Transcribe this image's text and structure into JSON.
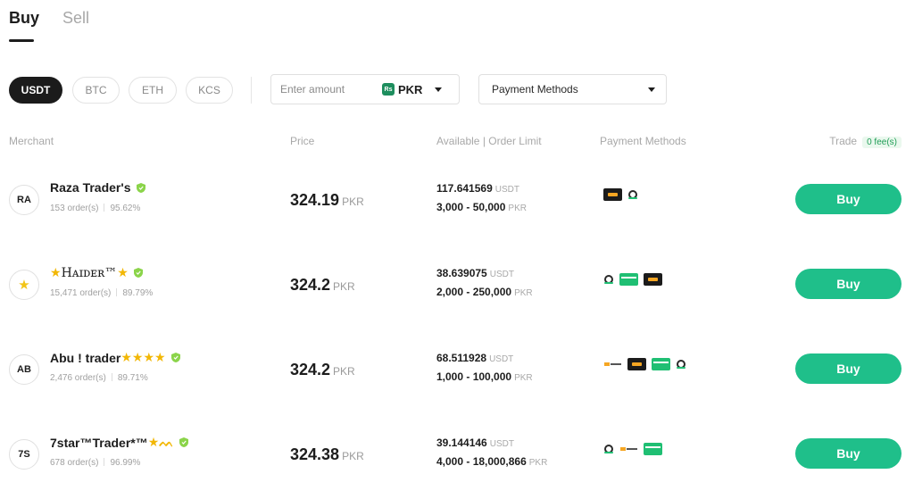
{
  "tabs": [
    {
      "label": "Buy",
      "active": true
    },
    {
      "label": "Sell",
      "active": false
    }
  ],
  "coins": [
    {
      "label": "USDT",
      "active": true
    },
    {
      "label": "BTC",
      "active": false
    },
    {
      "label": "ETH",
      "active": false
    },
    {
      "label": "KCS",
      "active": false
    }
  ],
  "amount": {
    "placeholder": "Enter amount",
    "currency": "PKR",
    "currency_icon": "Rs"
  },
  "payment_filter": {
    "label": "Payment Methods"
  },
  "headers": {
    "merchant": "Merchant",
    "price": "Price",
    "available": "Available | Order Limit",
    "payment": "Payment Methods",
    "trade": "Trade",
    "fee": "0 fee(s)"
  },
  "colors": {
    "accent": "#1fbf8a",
    "verified": "#8bd44a"
  },
  "rows": [
    {
      "avatar": "RA",
      "name": "Raza Trader's",
      "stars": "",
      "orders": "153 order(s)",
      "completion": "95.62%",
      "price": "324.19",
      "price_unit": "PKR",
      "available": "117.641569",
      "available_unit": "USDT",
      "limit": "3,000 - 50,000",
      "limit_unit": "PKR",
      "payment_methods": [
        "jazzcash-icon",
        "easypaisa-icon"
      ],
      "button": "Buy"
    },
    {
      "avatar": "★",
      "name": "Hᴀɪᴅᴇʀ™",
      "stars": "★",
      "stars_prefix": "★",
      "orders": "15,471 order(s)",
      "completion": "89.79%",
      "price": "324.2",
      "price_unit": "PKR",
      "available": "38.639075",
      "available_unit": "USDT",
      "limit": "2,000 - 250,000",
      "limit_unit": "PKR",
      "payment_methods": [
        "easypaisa-icon",
        "bank-card-icon",
        "jazzcash-icon"
      ],
      "button": "Buy"
    },
    {
      "avatar": "AB",
      "name": "Abu ! trader",
      "stars": "★★★★",
      "orders": "2,476 order(s)",
      "completion": "89.71%",
      "price": "324.2",
      "price_unit": "PKR",
      "available": "68.511928",
      "available_unit": "USDT",
      "limit": "1,000 - 100,000",
      "limit_unit": "PKR",
      "payment_methods": [
        "ubl-icon",
        "jazzcash-icon",
        "bank-card-icon",
        "easypaisa-icon"
      ],
      "button": "Buy"
    },
    {
      "avatar": "7S",
      "name": "7star™Trader*™",
      "stars": "★ᨓ",
      "orders": "678 order(s)",
      "completion": "96.99%",
      "price": "324.38",
      "price_unit": "PKR",
      "available": "39.144146",
      "available_unit": "USDT",
      "limit": "4,000 - 18,000,866",
      "limit_unit": "PKR",
      "payment_methods": [
        "easypaisa-icon",
        "ubl-icon",
        "bank-card-icon"
      ],
      "button": "Buy"
    }
  ]
}
